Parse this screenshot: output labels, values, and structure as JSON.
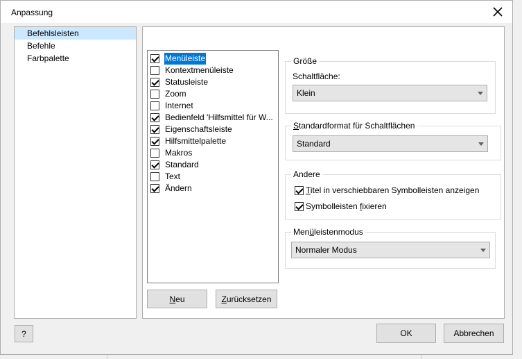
{
  "window": {
    "title": "Anpassung",
    "close_icon": "close-icon"
  },
  "nav": {
    "items": [
      {
        "label": "Befehlsleisten",
        "selected": true
      },
      {
        "label": "Befehle",
        "selected": false
      },
      {
        "label": "Farbpalette",
        "selected": false
      }
    ]
  },
  "toolbars": {
    "items": [
      {
        "label": "Menüleiste",
        "checked": true,
        "selected": true
      },
      {
        "label": "Kontextmenüleiste",
        "checked": false,
        "selected": false
      },
      {
        "label": "Statusleiste",
        "checked": true,
        "selected": false
      },
      {
        "label": "Zoom",
        "checked": false,
        "selected": false
      },
      {
        "label": "Internet",
        "checked": false,
        "selected": false
      },
      {
        "label": "Bedienfeld 'Hilfsmittel für W...",
        "checked": true,
        "selected": false
      },
      {
        "label": "Eigenschaftsleiste",
        "checked": true,
        "selected": false
      },
      {
        "label": "Hilfsmittelpalette",
        "checked": true,
        "selected": false
      },
      {
        "label": "Makros",
        "checked": false,
        "selected": false
      },
      {
        "label": "Standard",
        "checked": true,
        "selected": false
      },
      {
        "label": "Text",
        "checked": false,
        "selected": false
      },
      {
        "label": "Ändern",
        "checked": true,
        "selected": false
      }
    ],
    "new_button": {
      "prefix": "",
      "ul": "N",
      "suffix": "eu"
    },
    "reset_button": {
      "prefix": "",
      "ul": "Z",
      "suffix": "urücksetzen"
    }
  },
  "size_group": {
    "title": "Größe",
    "button_label": "Schaltfläche:",
    "button_value": "Klein"
  },
  "format_group": {
    "title_ul": "S",
    "title_rest": "tandardformat für Schaltflächen",
    "value": "Standard"
  },
  "other_group": {
    "title": "Andere",
    "opt1": {
      "prefix": "",
      "ul": "T",
      "suffix": "itel in verschiebbaren Symbolleisten anzeigen",
      "checked": true
    },
    "opt2": {
      "prefix": "Symbolleisten ",
      "ul": "f",
      "suffix": "ixieren",
      "checked": true
    }
  },
  "menu_mode_group": {
    "title_prefix": "Men",
    "title_ul": "ü",
    "title_rest": "leistenmodus",
    "value": "Normaler Modus"
  },
  "footer": {
    "help": "?",
    "ok": "OK",
    "cancel": "Abbrechen"
  }
}
